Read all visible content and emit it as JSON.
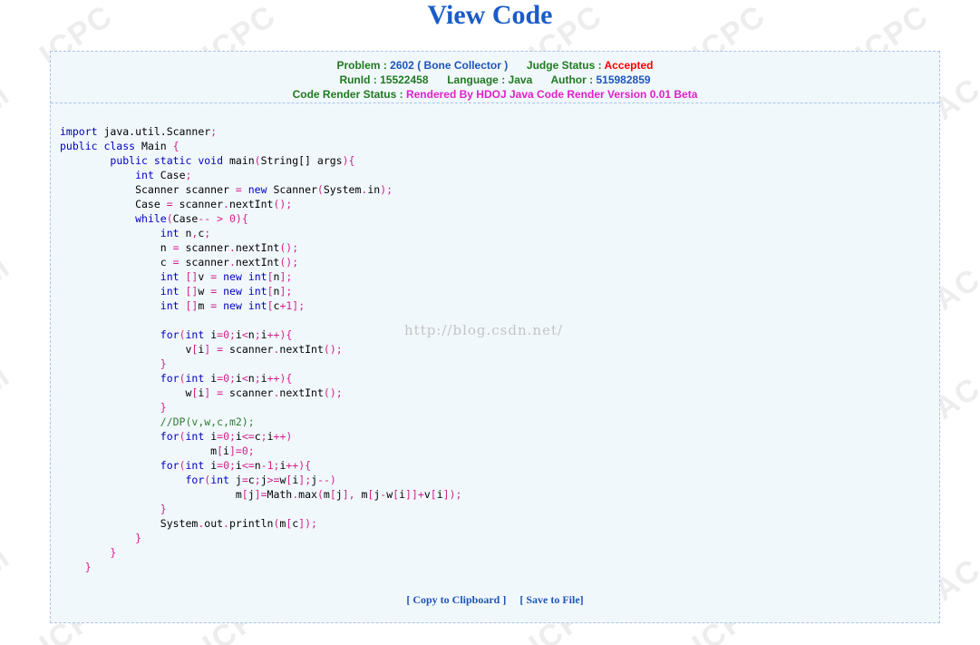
{
  "header": {
    "title": "View Code"
  },
  "info": {
    "problem_label": "Problem :",
    "problem_id": "2602",
    "problem_name": "( Bone Collector )",
    "judge_label": "Judge Status :",
    "judge_status": "Accepted",
    "runid_label": "RunId :",
    "runid": "15522458",
    "language_label": "Language :",
    "language": "Java",
    "author_label": "Author :",
    "author": "515982859",
    "render_label": "Code Render Status :",
    "render_status": "Rendered By HDOJ Java Code Render Version 0.01 Beta"
  },
  "watermark_url": "http://blog.csdn.net/",
  "actions": {
    "copy": "[ Copy to Clipboard ]",
    "save": "[ Save to File]"
  },
  "colors": {
    "title": "#1a5cc8",
    "label": "#1f7a1f",
    "value": "#1f55b7",
    "accepted": "#ff0000",
    "render": "#e020c8",
    "panel_bg": "#f1f8fc"
  },
  "code_lines": [
    [
      [
        "import",
        "kw"
      ],
      [
        " java.util.Scanner",
        ""
      ],
      [
        ";",
        "op"
      ]
    ],
    [
      [
        "public class",
        "kw"
      ],
      [
        " Main ",
        ""
      ],
      [
        "{",
        "op"
      ]
    ],
    [
      [
        "        ",
        ""
      ],
      [
        "public static void",
        "kw"
      ],
      [
        " main",
        ""
      ],
      [
        "(",
        "op"
      ],
      [
        "String[]",
        ""
      ],
      [
        " args",
        ""
      ],
      [
        ")",
        "op"
      ],
      [
        "{",
        "op"
      ]
    ],
    [
      [
        "            ",
        ""
      ],
      [
        "int",
        "kw"
      ],
      [
        " Case",
        ""
      ],
      [
        ";",
        "op"
      ]
    ],
    [
      [
        "            Scanner scanner ",
        ""
      ],
      [
        "=",
        "op"
      ],
      [
        " ",
        ""
      ],
      [
        "new",
        "kw"
      ],
      [
        " Scanner",
        ""
      ],
      [
        "(",
        "op"
      ],
      [
        "System",
        ""
      ],
      [
        ".",
        "op"
      ],
      [
        "in",
        ""
      ],
      [
        ")",
        "op"
      ],
      [
        ";",
        "op"
      ]
    ],
    [
      [
        "            Case ",
        ""
      ],
      [
        "=",
        "op"
      ],
      [
        " scanner",
        ""
      ],
      [
        ".",
        "op"
      ],
      [
        "nextInt",
        ""
      ],
      [
        "()",
        "op"
      ],
      [
        ";",
        "op"
      ]
    ],
    [
      [
        "            ",
        ""
      ],
      [
        "while",
        "kw"
      ],
      [
        "(",
        "op"
      ],
      [
        "Case",
        ""
      ],
      [
        "-- > 0",
        "op"
      ],
      [
        ")",
        "op"
      ],
      [
        "{",
        "op"
      ]
    ],
    [
      [
        "                ",
        ""
      ],
      [
        "int",
        "kw"
      ],
      [
        " n",
        ""
      ],
      [
        ",",
        "op"
      ],
      [
        "c",
        ""
      ],
      [
        ";",
        "op"
      ]
    ],
    [
      [
        "                n ",
        ""
      ],
      [
        "=",
        "op"
      ],
      [
        " scanner",
        ""
      ],
      [
        ".",
        "op"
      ],
      [
        "nextInt",
        ""
      ],
      [
        "()",
        "op"
      ],
      [
        ";",
        "op"
      ]
    ],
    [
      [
        "                c ",
        ""
      ],
      [
        "=",
        "op"
      ],
      [
        " scanner",
        ""
      ],
      [
        ".",
        "op"
      ],
      [
        "nextInt",
        ""
      ],
      [
        "()",
        "op"
      ],
      [
        ";",
        "op"
      ]
    ],
    [
      [
        "                ",
        ""
      ],
      [
        "int",
        "kw"
      ],
      [
        " ",
        ""
      ],
      [
        "[]",
        "op"
      ],
      [
        "v ",
        ""
      ],
      [
        "=",
        "op"
      ],
      [
        " ",
        ""
      ],
      [
        "new int",
        "kw"
      ],
      [
        "[",
        "op"
      ],
      [
        "n",
        ""
      ],
      [
        "]",
        "op"
      ],
      [
        ";",
        "op"
      ]
    ],
    [
      [
        "                ",
        ""
      ],
      [
        "int",
        "kw"
      ],
      [
        " ",
        ""
      ],
      [
        "[]",
        "op"
      ],
      [
        "w ",
        ""
      ],
      [
        "=",
        "op"
      ],
      [
        " ",
        ""
      ],
      [
        "new int",
        "kw"
      ],
      [
        "[",
        "op"
      ],
      [
        "n",
        ""
      ],
      [
        "]",
        "op"
      ],
      [
        ";",
        "op"
      ]
    ],
    [
      [
        "                ",
        ""
      ],
      [
        "int",
        "kw"
      ],
      [
        " ",
        ""
      ],
      [
        "[]",
        "op"
      ],
      [
        "m ",
        ""
      ],
      [
        "=",
        "op"
      ],
      [
        " ",
        ""
      ],
      [
        "new int",
        "kw"
      ],
      [
        "[",
        "op"
      ],
      [
        "c",
        ""
      ],
      [
        "+1",
        "op"
      ],
      [
        "]",
        "op"
      ],
      [
        ";",
        "op"
      ]
    ],
    [
      [
        "",
        ""
      ]
    ],
    [
      [
        "                ",
        ""
      ],
      [
        "for",
        "kw"
      ],
      [
        "(",
        "op"
      ],
      [
        "int",
        "kw"
      ],
      [
        " i",
        ""
      ],
      [
        "=0;",
        "op"
      ],
      [
        "i",
        ""
      ],
      [
        "<",
        "op"
      ],
      [
        "n",
        ""
      ],
      [
        ";",
        "op"
      ],
      [
        "i",
        ""
      ],
      [
        "++",
        "op"
      ],
      [
        ")",
        "op"
      ],
      [
        "{",
        "op"
      ]
    ],
    [
      [
        "                    v",
        ""
      ],
      [
        "[",
        "op"
      ],
      [
        "i",
        ""
      ],
      [
        "]",
        "op"
      ],
      [
        " ",
        ""
      ],
      [
        "=",
        "op"
      ],
      [
        " scanner",
        ""
      ],
      [
        ".",
        "op"
      ],
      [
        "nextInt",
        ""
      ],
      [
        "()",
        "op"
      ],
      [
        ";",
        "op"
      ]
    ],
    [
      [
        "                ",
        ""
      ],
      [
        "}",
        "op"
      ]
    ],
    [
      [
        "                ",
        ""
      ],
      [
        "for",
        "kw"
      ],
      [
        "(",
        "op"
      ],
      [
        "int",
        "kw"
      ],
      [
        " i",
        ""
      ],
      [
        "=0;",
        "op"
      ],
      [
        "i",
        ""
      ],
      [
        "<",
        "op"
      ],
      [
        "n",
        ""
      ],
      [
        ";",
        "op"
      ],
      [
        "i",
        ""
      ],
      [
        "++",
        "op"
      ],
      [
        ")",
        "op"
      ],
      [
        "{",
        "op"
      ]
    ],
    [
      [
        "                    w",
        ""
      ],
      [
        "[",
        "op"
      ],
      [
        "i",
        ""
      ],
      [
        "]",
        "op"
      ],
      [
        " ",
        ""
      ],
      [
        "=",
        "op"
      ],
      [
        " scanner",
        ""
      ],
      [
        ".",
        "op"
      ],
      [
        "nextInt",
        ""
      ],
      [
        "()",
        "op"
      ],
      [
        ";",
        "op"
      ]
    ],
    [
      [
        "                ",
        ""
      ],
      [
        "}",
        "op"
      ]
    ],
    [
      [
        "                ",
        ""
      ],
      [
        "//DP(v,w,c,m2);",
        "cm"
      ]
    ],
    [
      [
        "                ",
        ""
      ],
      [
        "for",
        "kw"
      ],
      [
        "(",
        "op"
      ],
      [
        "int",
        "kw"
      ],
      [
        " i",
        ""
      ],
      [
        "=0;",
        "op"
      ],
      [
        "i",
        ""
      ],
      [
        "<=",
        "op"
      ],
      [
        "c",
        ""
      ],
      [
        ";",
        "op"
      ],
      [
        "i",
        ""
      ],
      [
        "++",
        "op"
      ],
      [
        ")",
        "op"
      ]
    ],
    [
      [
        "                        m",
        ""
      ],
      [
        "[",
        "op"
      ],
      [
        "i",
        ""
      ],
      [
        "]=0;",
        "op"
      ]
    ],
    [
      [
        "                ",
        ""
      ],
      [
        "for",
        "kw"
      ],
      [
        "(",
        "op"
      ],
      [
        "int",
        "kw"
      ],
      [
        " i",
        ""
      ],
      [
        "=0;",
        "op"
      ],
      [
        "i",
        ""
      ],
      [
        "<=",
        "op"
      ],
      [
        "n",
        ""
      ],
      [
        "-1;",
        "op"
      ],
      [
        "i",
        ""
      ],
      [
        "++",
        "op"
      ],
      [
        ")",
        "op"
      ],
      [
        "{",
        "op"
      ]
    ],
    [
      [
        "                    ",
        ""
      ],
      [
        "for",
        "kw"
      ],
      [
        "(",
        "op"
      ],
      [
        "int",
        "kw"
      ],
      [
        " j",
        ""
      ],
      [
        "=",
        "op"
      ],
      [
        "c",
        ""
      ],
      [
        ";",
        "op"
      ],
      [
        "j",
        ""
      ],
      [
        ">=",
        "op"
      ],
      [
        "w",
        ""
      ],
      [
        "[",
        "op"
      ],
      [
        "i",
        ""
      ],
      [
        "];",
        "op"
      ],
      [
        "j",
        ""
      ],
      [
        "--",
        "op"
      ],
      [
        ")",
        "op"
      ]
    ],
    [
      [
        "                            m",
        ""
      ],
      [
        "[",
        "op"
      ],
      [
        "j",
        ""
      ],
      [
        "]=",
        "op"
      ],
      [
        "Math",
        ""
      ],
      [
        ".",
        "op"
      ],
      [
        "max",
        ""
      ],
      [
        "(",
        "op"
      ],
      [
        "m",
        ""
      ],
      [
        "[",
        "op"
      ],
      [
        "j",
        ""
      ],
      [
        "],",
        "op"
      ],
      [
        " m",
        ""
      ],
      [
        "[",
        "op"
      ],
      [
        "j",
        ""
      ],
      [
        "-",
        "op"
      ],
      [
        "w",
        ""
      ],
      [
        "[",
        "op"
      ],
      [
        "i",
        ""
      ],
      [
        "]]+",
        "op"
      ],
      [
        "v",
        ""
      ],
      [
        "[",
        "op"
      ],
      [
        "i",
        ""
      ],
      [
        "]);",
        "op"
      ]
    ],
    [
      [
        "                ",
        ""
      ],
      [
        "}",
        "op"
      ]
    ],
    [
      [
        "                System",
        ""
      ],
      [
        ".",
        "op"
      ],
      [
        "out",
        ""
      ],
      [
        ".",
        "op"
      ],
      [
        "println",
        ""
      ],
      [
        "(",
        "op"
      ],
      [
        "m",
        ""
      ],
      [
        "[",
        "op"
      ],
      [
        "c",
        ""
      ],
      [
        "]);",
        "op"
      ]
    ],
    [
      [
        "            ",
        ""
      ],
      [
        "}",
        "op"
      ]
    ],
    [
      [
        "        ",
        ""
      ],
      [
        "}",
        "op"
      ]
    ],
    [
      [
        "    ",
        ""
      ],
      [
        "}",
        "op"
      ]
    ]
  ]
}
